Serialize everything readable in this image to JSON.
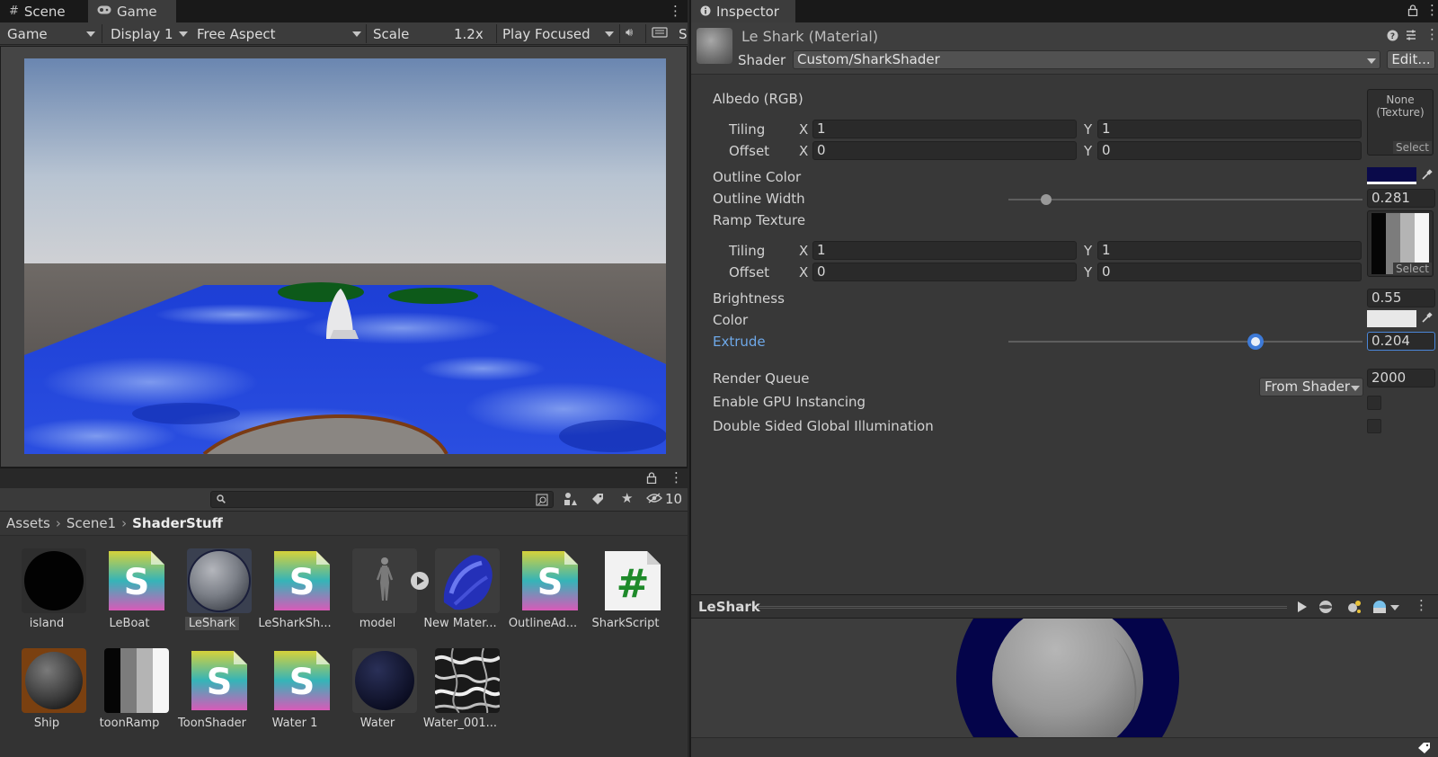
{
  "tabs_left": {
    "scene": "Scene",
    "game": "Game"
  },
  "game_toolbar": {
    "mode": "Game",
    "display": "Display 1",
    "aspect": "Free Aspect",
    "scale_label": "Scale",
    "scale_value": "1.2x",
    "play_mode": "Play Focused",
    "overflow_letter": "S"
  },
  "project": {
    "hidden_count": "10",
    "breadcrumb": [
      "Assets",
      "Scene1",
      "ShaderStuff"
    ],
    "assets_row1": [
      {
        "label": "island",
        "icon": "sphere-black-icon"
      },
      {
        "label": "LeBoat",
        "icon": "shader-s-icon"
      },
      {
        "label": "LeShark",
        "icon": "material-grey-icon"
      },
      {
        "label": "LeSharkSh...",
        "icon": "shader-s-icon"
      },
      {
        "label": "model",
        "icon": "model-figure-icon"
      },
      {
        "label": "New Mater...",
        "icon": "material-blue-icon"
      },
      {
        "label": "OutlineAd...",
        "icon": "shader-s-icon"
      },
      {
        "label": "SharkScript",
        "icon": "csharp-script-icon"
      }
    ],
    "assets_row2": [
      {
        "label": "Ship",
        "icon": "material-ship-icon"
      },
      {
        "label": "toonRamp",
        "icon": "ramp-texture-icon"
      },
      {
        "label": "ToonShader",
        "icon": "shader-s-icon"
      },
      {
        "label": "Water 1",
        "icon": "shader-s-icon"
      },
      {
        "label": "Water",
        "icon": "material-navy-icon"
      },
      {
        "label": "Water_001...",
        "icon": "noise-texture-icon"
      }
    ]
  },
  "inspector": {
    "tab": "Inspector",
    "title": "Le Shark (Material)",
    "shader_label": "Shader",
    "shader_value": "Custom/SharkShader",
    "edit_button": "Edit...",
    "albedo_label": "Albedo (RGB)",
    "albedo_slot_text": "None\n(Texture)",
    "select": "Select",
    "tiling_label": "Tiling",
    "offset_label": "Offset",
    "x": "X",
    "y": "Y",
    "albedo_tiling": [
      "1",
      "1"
    ],
    "albedo_offset": [
      "0",
      "0"
    ],
    "outline_color_label": "Outline Color",
    "outline_width_label": "Outline Width",
    "outline_width_value": "0.281",
    "ramp_label": "Ramp Texture",
    "ramp_tiling": [
      "1",
      "1"
    ],
    "ramp_offset": [
      "0",
      "0"
    ],
    "brightness_label": "Brightness",
    "brightness_value": "0.55",
    "color_label": "Color",
    "extrude_label": "Extrude",
    "extrude_value": "0.204",
    "render_queue_label": "Render Queue",
    "render_queue_mode": "From Shader",
    "render_queue_value": "2000",
    "gpu_instancing_label": "Enable GPU Instancing",
    "double_sided_gi_label": "Double Sided Global Illumination",
    "preview_name": "LeShark"
  },
  "colors": {
    "outline_color": "#0a0a4a",
    "color": "#e8e8e8",
    "accent": "#6ea8e8"
  }
}
